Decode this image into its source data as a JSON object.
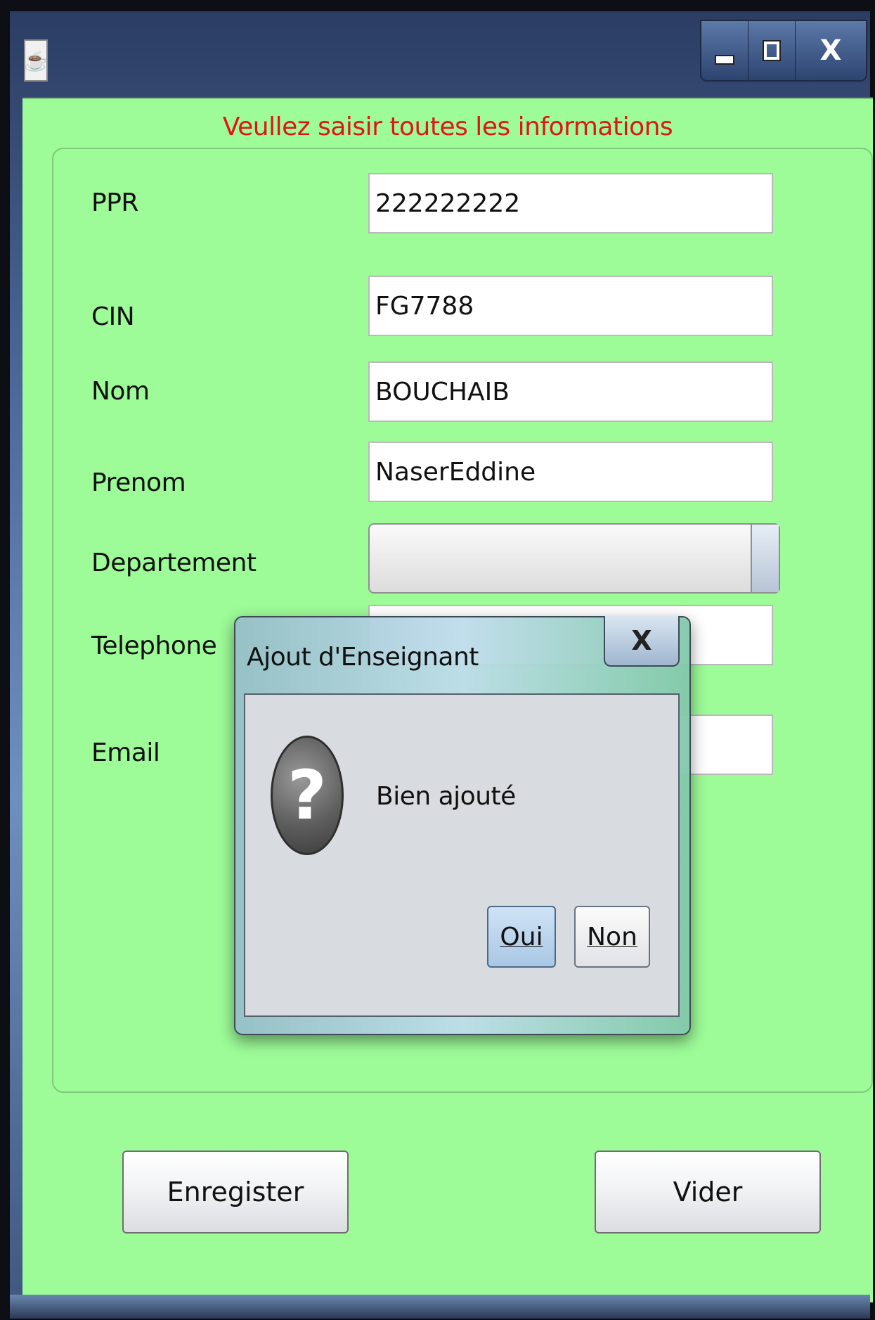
{
  "window": {
    "title": "",
    "app_icon": "java-coffee-icon",
    "controls": {
      "minimize_icon": "minimize-icon",
      "maximize_icon": "maximize-icon",
      "close_label": "X"
    }
  },
  "form": {
    "header_message": "Veullez saisir toutes les informations",
    "header_color": "#e31414",
    "background_color": "#9dfb98",
    "fields": {
      "ppr": {
        "label": "PPR",
        "value": "222222222"
      },
      "cin": {
        "label": "CIN",
        "value": "FG7788"
      },
      "nom": {
        "label": "Nom",
        "value": "BOUCHAIB"
      },
      "prenom": {
        "label": "Prenom",
        "value": "NaserEddine"
      },
      "departement": {
        "label": "Departement",
        "value": ""
      },
      "telephone": {
        "label": "Telephone",
        "value": ""
      },
      "email": {
        "label": "Email",
        "value": ""
      }
    },
    "buttons": {
      "save_label": "Enregister",
      "clear_label": "Vider"
    }
  },
  "dialog": {
    "title": "Ajout d'Enseignant",
    "close_label": "X",
    "icon": "question-icon",
    "message": "Bien ajouté",
    "yes_label": "Oui",
    "no_label": "Non"
  }
}
